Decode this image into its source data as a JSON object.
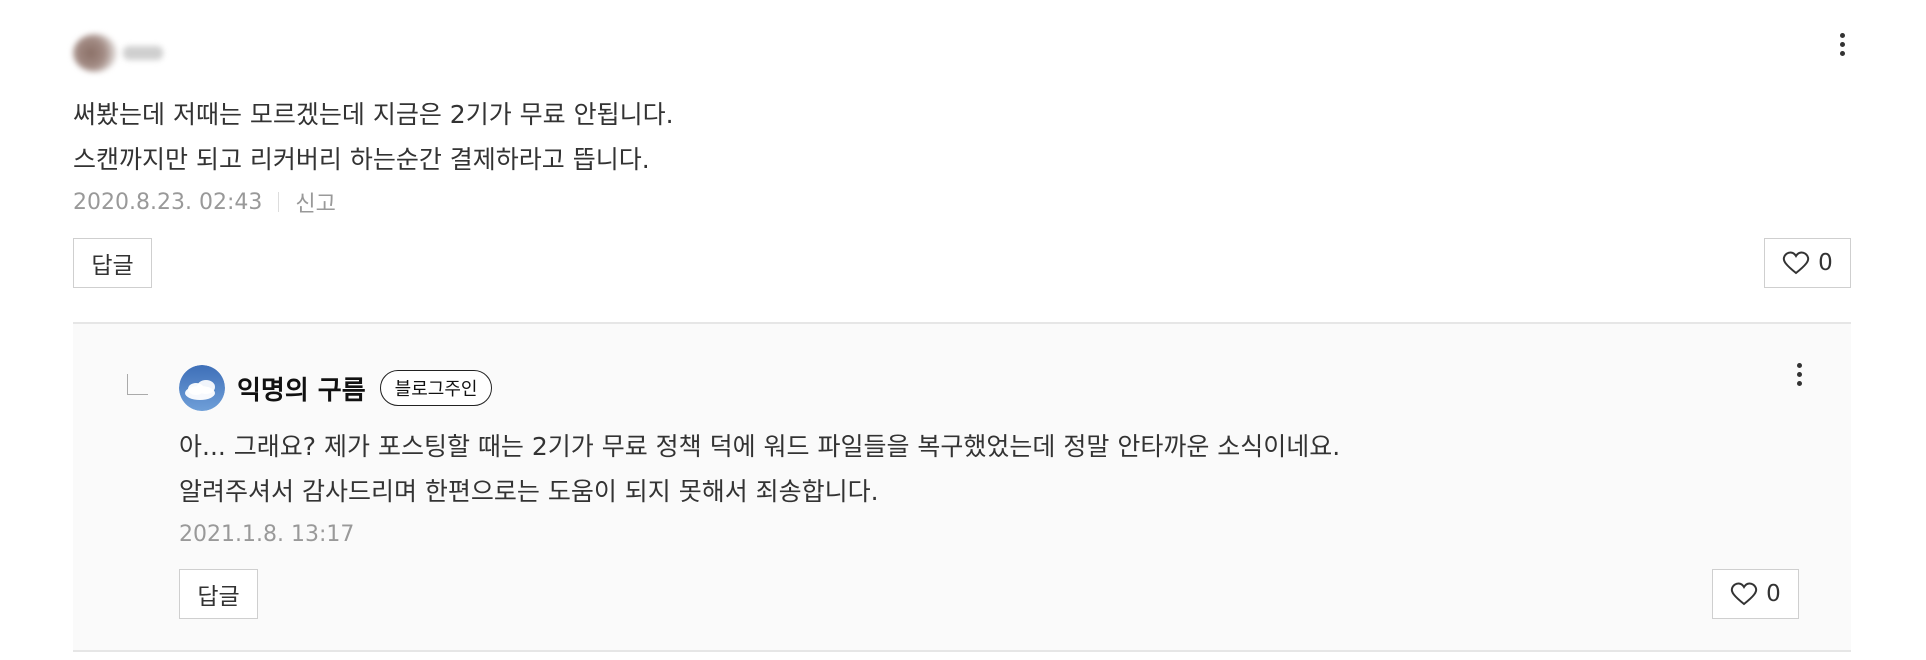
{
  "comment": {
    "lines": [
      "써봤는데 저때는 모르겠는데 지금은 2기가 무료 안됩니다.",
      "스캔까지만 되고 리커버리 하는순간 결제하라고 뜹니다."
    ],
    "date": "2020.8.23. 02:43",
    "report_label": "신고",
    "reply_label": "답글",
    "like_count": "0"
  },
  "reply": {
    "author": "익명의 구름",
    "badge": "블로그주인",
    "lines": [
      "아... 그래요? 제가 포스팅할 때는 2기가 무료 정책 덕에 워드 파일들을 복구했었는데 정말 안타까운 소식이네요.",
      "알려주셔서 감사드리며 한편으로는 도움이 되지 못해서 죄송합니다."
    ],
    "date": "2021.1.8. 13:17",
    "reply_label": "답글",
    "like_count": "0"
  },
  "icons": {
    "more": "more-vertical-icon",
    "like": "heart-outline-icon",
    "reply_indicator": "reply-corner-icon",
    "avatar": "cloud-avatar"
  },
  "colors": {
    "text": "#333333",
    "meta": "#999999",
    "border": "#cfcfcf",
    "reply_background": "#fafafa"
  }
}
